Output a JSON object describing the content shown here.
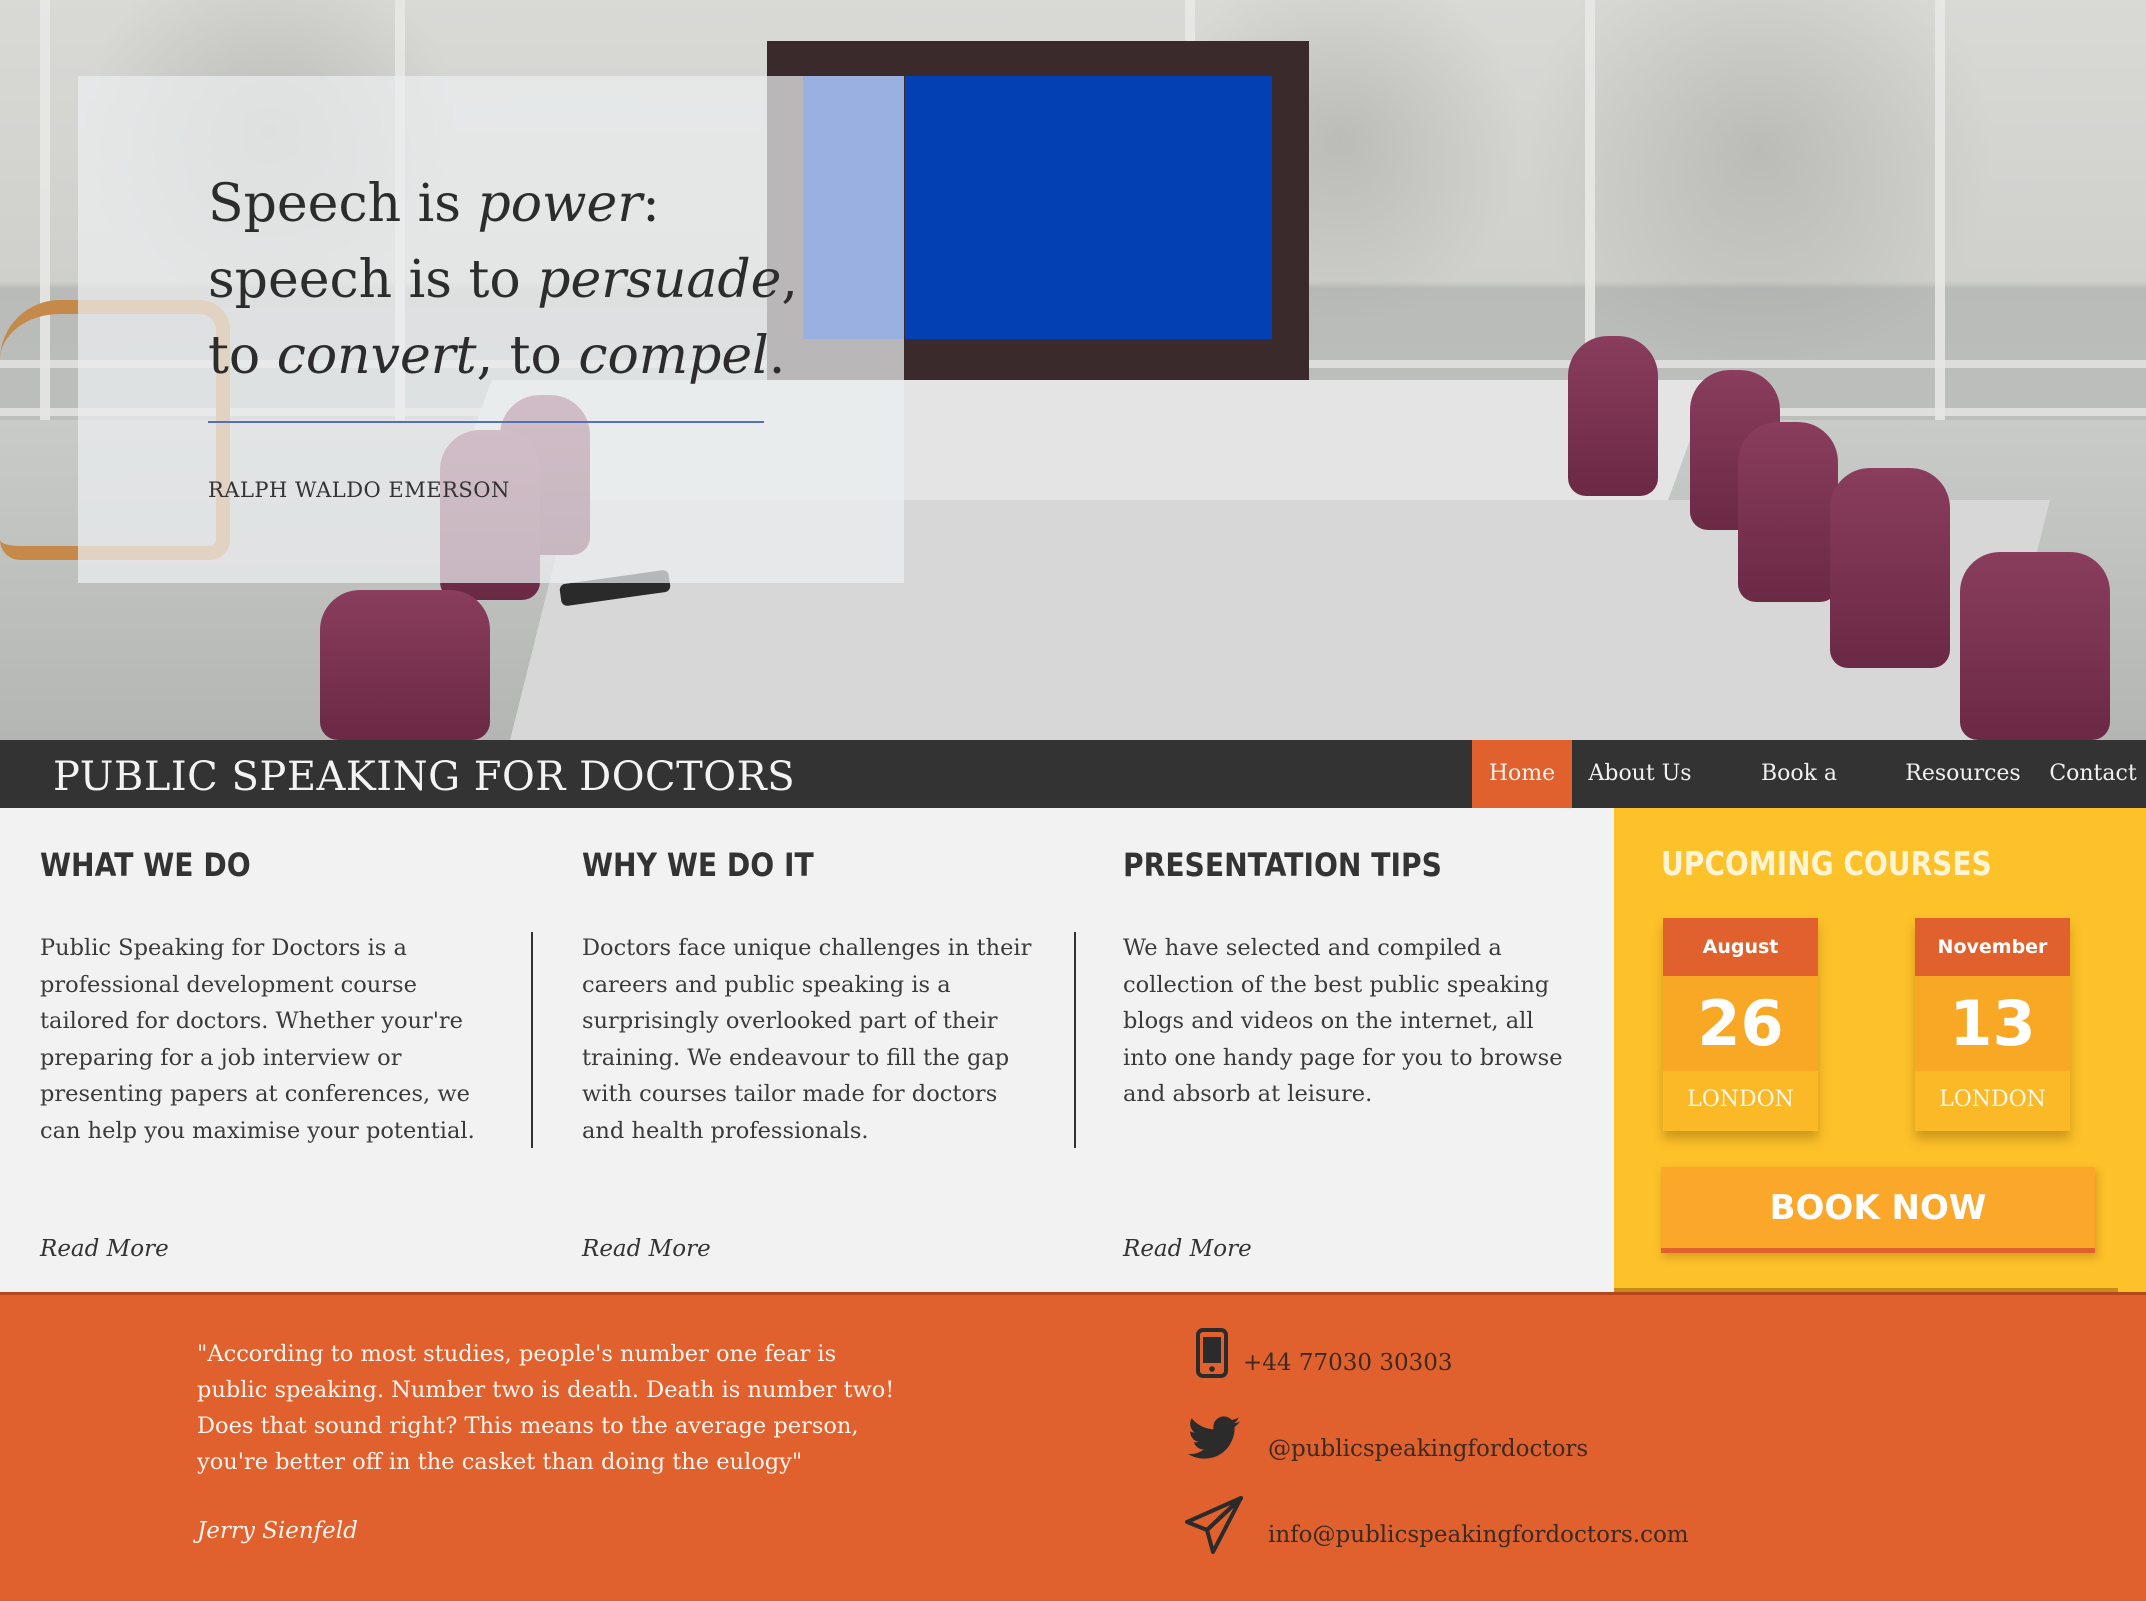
{
  "hero": {
    "quote_parts": [
      {
        "text": "Speech is ",
        "italic": false
      },
      {
        "text": "power",
        "italic": true
      },
      {
        "text": ":",
        "italic": false
      },
      {
        "text": "\n",
        "italic": false
      },
      {
        "text": "speech is to ",
        "italic": false
      },
      {
        "text": "persuade",
        "italic": true
      },
      {
        "text": ",",
        "italic": false
      },
      {
        "text": "\n",
        "italic": false
      },
      {
        "text": "to ",
        "italic": false
      },
      {
        "text": "convert",
        "italic": true
      },
      {
        "text": ", to ",
        "italic": false
      },
      {
        "text": "compel",
        "italic": true
      },
      {
        "text": ".",
        "italic": false
      }
    ],
    "author": "RALPH WALDO EMERSON"
  },
  "header": {
    "site_title": "PUBLIC SPEAKING FOR DOCTORS"
  },
  "nav": {
    "items": [
      {
        "label": "Home",
        "active": true
      },
      {
        "label": "About Us",
        "active": false
      },
      {
        "label": "Book a Course",
        "active": false
      },
      {
        "label": "Resources",
        "active": false
      },
      {
        "label": "Contact",
        "active": false
      }
    ]
  },
  "columns": [
    {
      "heading": "WHAT WE DO",
      "body": "Public Speaking for Doctors is a professional development course tailored for doctors. Whether your're preparing for a job interview or presenting papers at conferences, we can help you maximise your potential.",
      "read_more": "Read More"
    },
    {
      "heading": "WHY WE DO IT",
      "body": "Doctors face unique challenges in their careers and public speaking is a surprisingly overlooked part of their training. We endeavour to fill the gap with courses tailor made for doctors and health professionals.",
      "read_more": "Read More"
    },
    {
      "heading": "PRESENTATION TIPS",
      "body": "We have selected and compiled a collection of the best public speaking blogs and videos on the internet, all into one handy page for you to browse and absorb at leisure.",
      "read_more": "Read More"
    }
  ],
  "courses": {
    "title": "UPCOMING COURSES",
    "dates": [
      {
        "month": "August",
        "day": "26",
        "city": "LONDON"
      },
      {
        "month": "November",
        "day": "13",
        "city": "LONDON"
      }
    ],
    "book_label": "BOOK NOW"
  },
  "footer": {
    "quote": "\"According to most studies, people's number one fear is public speaking. Number two is death. Death is number two! Does that sound right? This means to the average person, you're better off in the casket than doing the eulogy\"",
    "quote_author": "Jerry Sienfeld",
    "contacts": [
      {
        "icon": "phone-icon",
        "text": "+44 77030 30303"
      },
      {
        "icon": "twitter-icon",
        "text": "@publicspeakingfordoctors"
      },
      {
        "icon": "paper-plane-icon",
        "text": "info@publicspeakingfordoctors.com"
      }
    ]
  },
  "colors": {
    "accent_orange": "#e0612d",
    "accent_yellow": "#fdc12a",
    "navbar": "#333333",
    "tv_screen_blue": "#0340b3"
  }
}
